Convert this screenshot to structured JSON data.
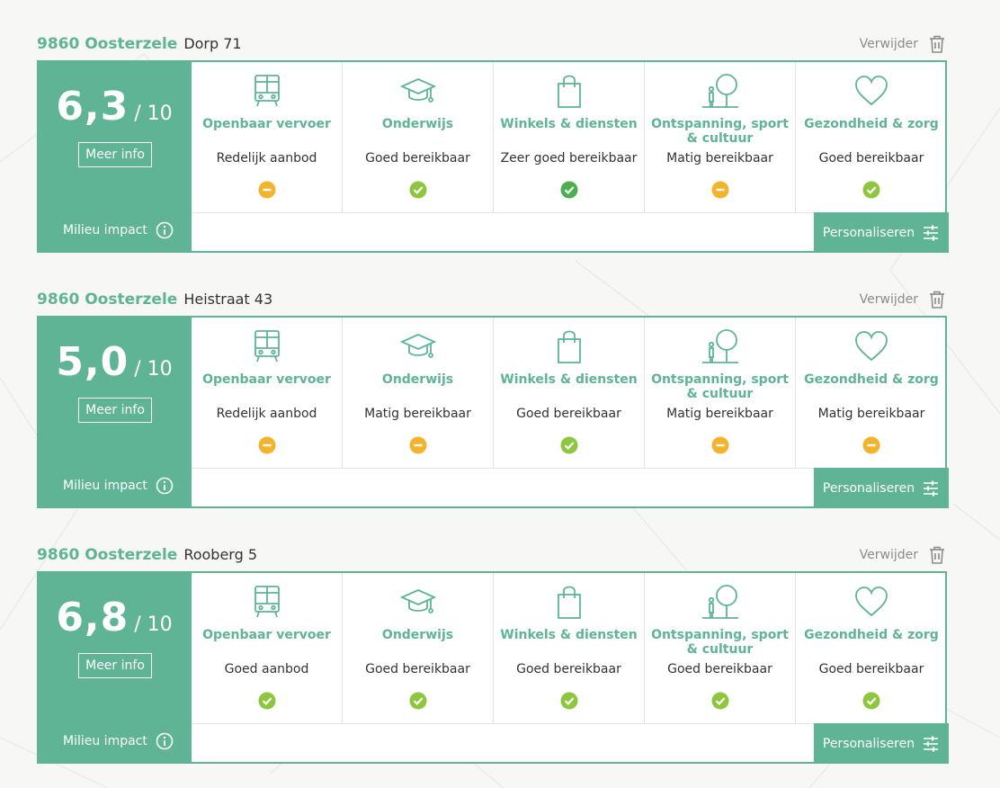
{
  "colors": {
    "accent": "#5fb496",
    "status_ok": "#8ec63f",
    "status_good": "#4cae4f",
    "status_medium": "#f2b42d",
    "background": "#f7f7f6"
  },
  "common": {
    "score_max": "/ 10",
    "more_info_label": "Meer info",
    "environment_label": "Milieu impact",
    "personalize_label": "Personaliseren",
    "remove_label": "Verwijder",
    "categories": [
      {
        "label": "Openbaar vervoer",
        "icon": "bus-icon"
      },
      {
        "label": "Onderwijs",
        "icon": "graduation-cap-icon"
      },
      {
        "label": "Winkels & diensten",
        "icon": "shopping-bag-icon"
      },
      {
        "label": "Ontspanning, sport & cultuur",
        "icon": "tree-person-icon"
      },
      {
        "label": "Gezondheid & zorg",
        "icon": "heart-icon"
      }
    ]
  },
  "addresses": [
    {
      "city": "9860 Oosterzele",
      "street": "Dorp 71",
      "score": "6,3",
      "statuses": [
        {
          "text": "Redelijk aanbod",
          "level": "medium"
        },
        {
          "text": "Goed bereikbaar",
          "level": "ok"
        },
        {
          "text": "Zeer goed bereikbaar",
          "level": "good"
        },
        {
          "text": "Matig bereikbaar",
          "level": "medium"
        },
        {
          "text": "Goed bereikbaar",
          "level": "ok"
        }
      ]
    },
    {
      "city": "9860 Oosterzele",
      "street": "Heistraat 43",
      "score": "5,0",
      "statuses": [
        {
          "text": "Redelijk aanbod",
          "level": "medium"
        },
        {
          "text": "Matig bereikbaar",
          "level": "medium"
        },
        {
          "text": "Goed bereikbaar",
          "level": "ok"
        },
        {
          "text": "Matig bereikbaar",
          "level": "medium"
        },
        {
          "text": "Matig bereikbaar",
          "level": "medium"
        }
      ]
    },
    {
      "city": "9860 Oosterzele",
      "street": "Rooberg 5",
      "score": "6,8",
      "statuses": [
        {
          "text": "Goed aanbod",
          "level": "ok"
        },
        {
          "text": "Goed bereikbaar",
          "level": "ok"
        },
        {
          "text": "Goed bereikbaar",
          "level": "ok"
        },
        {
          "text": "Goed bereikbaar",
          "level": "ok"
        },
        {
          "text": "Goed bereikbaar",
          "level": "ok"
        }
      ]
    }
  ]
}
